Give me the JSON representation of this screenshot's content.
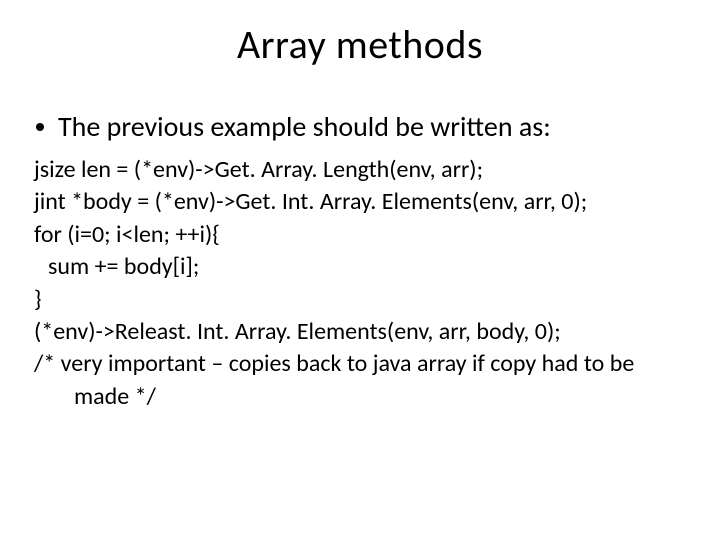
{
  "title": "Array methods",
  "bullet": "The previous example should be written as:",
  "code": {
    "l1": "jsize len = (*env)->Get. Array. Length(env, arr);",
    "l2": "jint *body = (*env)->Get. Int. Array. Elements(env, arr, 0);",
    "l3": "for (i=0; i<len; ++i){",
    "l4": "sum += body[i];",
    "l5": "}",
    "l6": "(*env)->Releast. Int. Array. Elements(env, arr, body, 0);",
    "l7": "/* very important – copies back to java array if copy had to be made */"
  }
}
